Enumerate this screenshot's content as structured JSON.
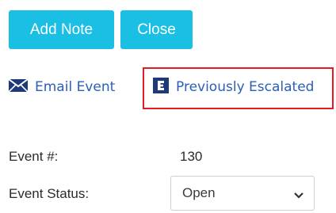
{
  "toolbar": {
    "add_note_label": "Add Note",
    "close_label": "Close"
  },
  "actions": {
    "email_event_label": "Email Event",
    "email_icon": "envelope-icon",
    "previously_escalated_label": "Previously Escalated",
    "escalated_icon": "escalated-e-icon"
  },
  "details": {
    "event_number_label": "Event #:",
    "event_number_value": "130",
    "event_status_label": "Event Status:",
    "event_status_value": "Open"
  },
  "colors": {
    "button_bg": "#1bbfe3",
    "link": "#2a5fb8",
    "highlight_border": "#e31b23"
  }
}
